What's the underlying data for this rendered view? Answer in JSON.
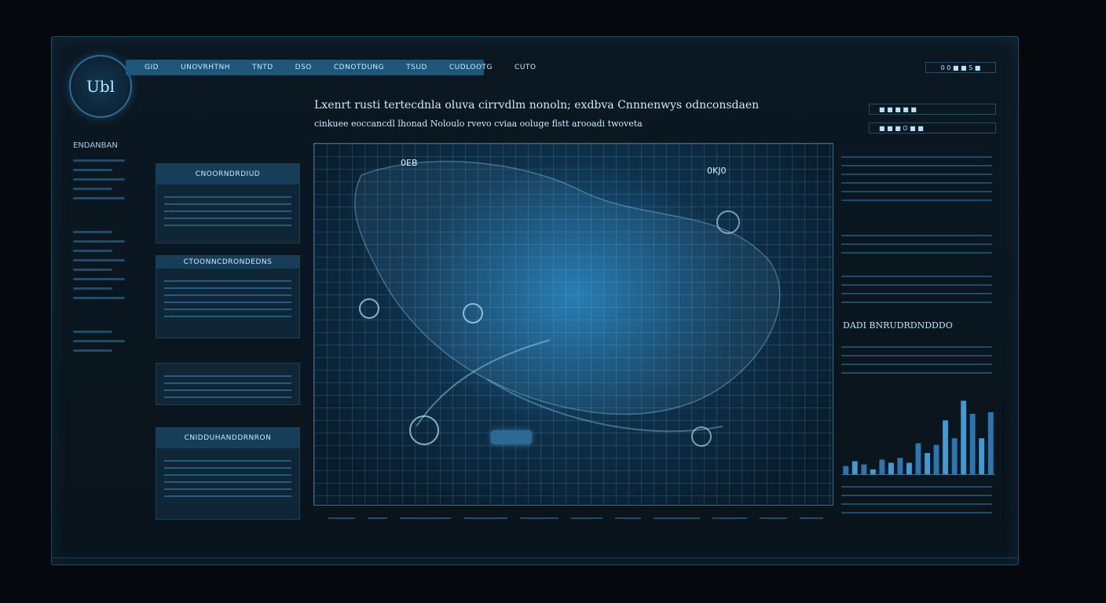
{
  "header": {
    "logo_text": "Ubl",
    "nav_items": [
      "GID",
      "UNOVRHTNH",
      "TNTD",
      "DSO",
      "CDNOTDUNG",
      "TSUD",
      "CUDLOOTG",
      "CUTO"
    ],
    "badge_text": "0 0 ■ ■ S ■"
  },
  "left_sidebar": {
    "title": "ENDANBAN"
  },
  "panels": [
    {
      "title": "CNOORNDRDIUD"
    },
    {
      "title": "CTOONNCDRONDEDNS"
    },
    {
      "title": "CNIDDUHANDDRNRON"
    }
  ],
  "main": {
    "heading": "Lxenrt rusti tertecdnla oluva cirrvdlm nonoln; exdbva Cnnnenwys odnconsdaen",
    "subheading": "cinkuee eoccancdl lhonad Noloulo rvevo cviaa ooluge flstt arooadi twoveta"
  },
  "map": {
    "label_a": "0EB",
    "label_b": "0KJ0"
  },
  "right_panel": {
    "box1": "■ ■ ■ ■ ■",
    "box2": "■ ■ ■ O ■ ■",
    "title": "DADI BNRUDRDNDDDO"
  },
  "chart_data": {
    "type": "bar",
    "values": [
      10,
      16,
      12,
      6,
      18,
      14,
      20,
      14,
      38,
      26,
      36,
      66,
      44,
      90,
      74,
      44,
      76
    ]
  }
}
